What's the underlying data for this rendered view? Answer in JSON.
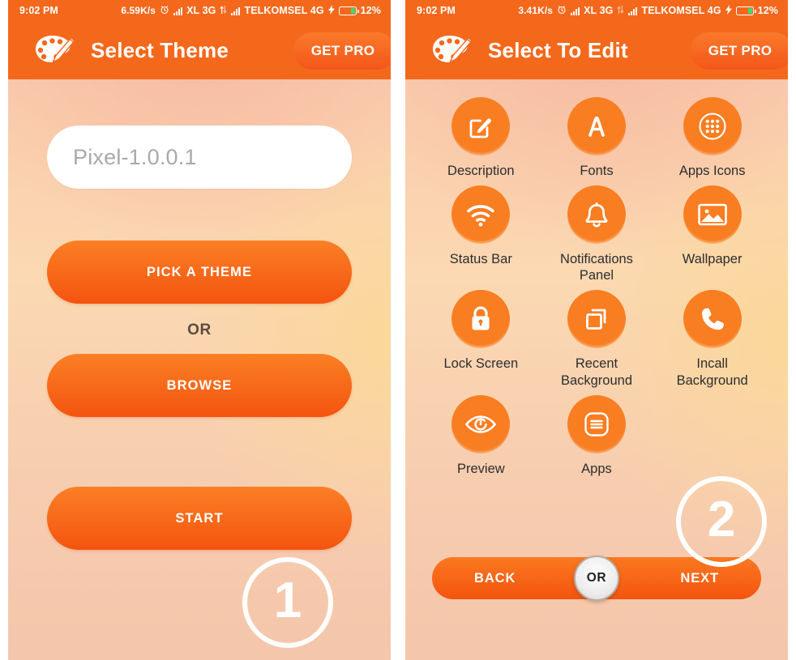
{
  "screens": [
    {
      "id": "select-theme",
      "status_bar": {
        "time": "9:02 PM",
        "net_speed": "6.59K/s",
        "alarm_icon": "alarm-icon",
        "sim1_label": "XL 3G",
        "sim2_label": "TELKOMSEL 4G",
        "charging_icon": "lightning-bolt-icon",
        "battery": "12%"
      },
      "header": {
        "logo_icon": "palette-icon",
        "title": "Select Theme",
        "pro_button": "GET PRO"
      },
      "theme_field": {
        "value": "Pixel-1.0.0.1",
        "placeholder": "Pixel-1.0.0.1"
      },
      "buttons": {
        "pick": "PICK A THEME",
        "or": "OR",
        "browse": "BROWSE",
        "start": "START"
      },
      "step_badge": "1"
    },
    {
      "id": "select-to-edit",
      "status_bar": {
        "time": "9:02 PM",
        "net_speed": "3.41K/s",
        "alarm_icon": "alarm-icon",
        "sim1_label": "XL 3G",
        "sim2_label": "TELKOMSEL 4G",
        "charging_icon": "lightning-bolt-icon",
        "battery": "12%"
      },
      "header": {
        "logo_icon": "palette-icon",
        "title": "Select To Edit",
        "pro_button": "GET PRO"
      },
      "grid": [
        {
          "label": "Description",
          "icon": "edit-square-pencil-icon"
        },
        {
          "label": "Fonts",
          "icon": "letter-a-icon"
        },
        {
          "label": "Apps Icons",
          "icon": "app-drawer-grid-icon"
        },
        {
          "label": "Status Bar",
          "icon": "wifi-icon"
        },
        {
          "label": "Notifications Panel",
          "icon": "bell-icon"
        },
        {
          "label": "Wallpaper",
          "icon": "image-photo-icon"
        },
        {
          "label": "Lock Screen",
          "icon": "lock-icon"
        },
        {
          "label": "Recent Background",
          "icon": "copy-windows-icon"
        },
        {
          "label": "Incall Background",
          "icon": "phone-handset-icon"
        },
        {
          "label": "Preview",
          "icon": "eye-icon"
        },
        {
          "label": "Apps",
          "icon": "rounded-square-lines-icon"
        }
      ],
      "nav": {
        "back": "BACK",
        "or": "OR",
        "next": "NEXT"
      },
      "step_badge": "2"
    }
  ],
  "colors": {
    "brand_orange": "#f4681c",
    "button_orange": "#f4540f",
    "badge_white": "#ffffff",
    "battery_green": "#3ddc6b",
    "placeholder_grey": "#a9a9a9"
  }
}
